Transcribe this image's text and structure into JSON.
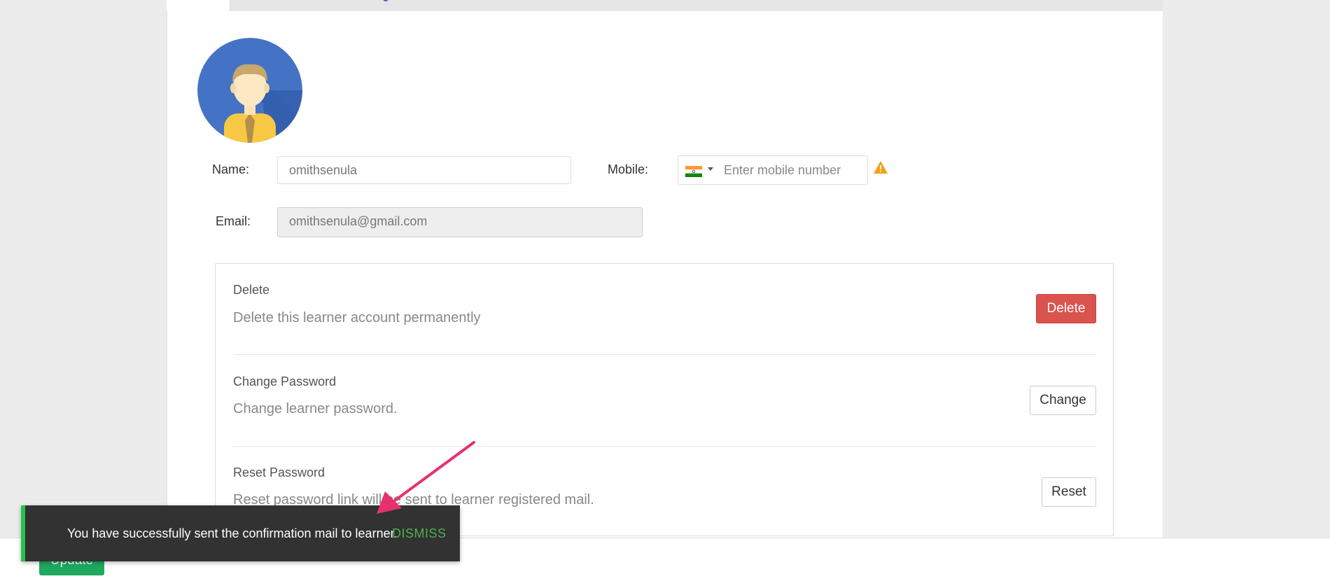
{
  "profile": {
    "name_label": "Name:",
    "name_value": "omithsenula",
    "mobile_label": "Mobile:",
    "mobile_placeholder": "Enter mobile number",
    "mobile_country_icon": "india-flag-icon",
    "mobile_warning_icon": "warning-triangle-icon",
    "email_label": "Email:",
    "email_value": "omithsenula@gmail.com"
  },
  "settings": [
    {
      "title": "Delete",
      "description": "Delete this learner account permanently",
      "button": "Delete"
    },
    {
      "title": "Change Password",
      "description": "Change learner password.",
      "button": "Change"
    },
    {
      "title": "Reset Password",
      "description": "Reset password link will be sent to learner registered mail.",
      "button": "Reset"
    }
  ],
  "footer": {
    "update_label": "Update"
  },
  "toast": {
    "message": "You have successfully sent the confirmation mail to learner.",
    "dismiss_label": "DISMISS"
  },
  "colors": {
    "danger": "#d9534f",
    "success": "#1ea95f",
    "toast_bg": "#323232",
    "toast_accent": "#27c24c",
    "warning": "#f0ad4e",
    "annotation_arrow": "#e8306e"
  }
}
